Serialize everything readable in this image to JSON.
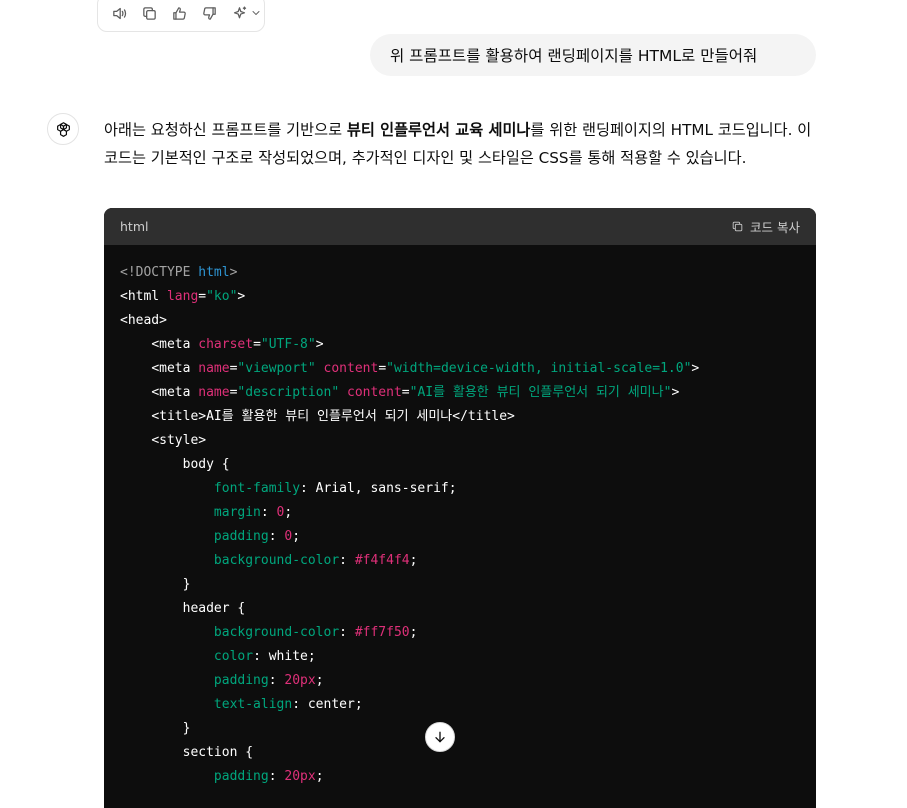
{
  "action_bar": {
    "icons": [
      "speaker-icon",
      "copy-icon",
      "thumbs-up-icon",
      "thumbs-down-icon",
      "sparkle-icon",
      "chevron-down-icon"
    ]
  },
  "user_message": "위 프롬프트를 활용하여 랜딩페이지를 HTML로 만들어줘",
  "assistant": {
    "intro_before": "아래는 요청하신 프롬프트를 기반으로 ",
    "intro_bold": "뷰티 인플루언서 교육 세미나",
    "intro_after": "를 위한 랜딩페이지의 HTML 코드입니다. 이 코드는 기본적인 구조로 작성되었으며, 추가적인 디자인 및 스타일은 CSS를 통해 적용할 수 있습니다."
  },
  "code_block": {
    "language": "html",
    "copy_label": "코드 복사",
    "lines": [
      [
        [
          "doctype",
          "<!DOCTYPE "
        ],
        [
          "kw",
          "html"
        ],
        [
          "doctype",
          ">"
        ]
      ],
      [
        [
          "tag",
          "<html "
        ],
        [
          "attr",
          "lang"
        ],
        [
          "tag",
          "="
        ],
        [
          "str",
          "\"ko\""
        ],
        [
          "tag",
          ">"
        ]
      ],
      [
        [
          "tag",
          "<head>"
        ]
      ],
      [
        [
          "plain",
          "    "
        ],
        [
          "tag",
          "<meta "
        ],
        [
          "attr",
          "charset"
        ],
        [
          "tag",
          "="
        ],
        [
          "str",
          "\"UTF-8\""
        ],
        [
          "tag",
          ">"
        ]
      ],
      [
        [
          "plain",
          "    "
        ],
        [
          "tag",
          "<meta "
        ],
        [
          "attr",
          "name"
        ],
        [
          "tag",
          "="
        ],
        [
          "str",
          "\"viewport\""
        ],
        [
          "plain",
          " "
        ],
        [
          "attr",
          "content"
        ],
        [
          "tag",
          "="
        ],
        [
          "str",
          "\"width=device-width, initial-scale=1.0\""
        ],
        [
          "tag",
          ">"
        ]
      ],
      [
        [
          "plain",
          "    "
        ],
        [
          "tag",
          "<meta "
        ],
        [
          "attr",
          "name"
        ],
        [
          "tag",
          "="
        ],
        [
          "str",
          "\"description\""
        ],
        [
          "plain",
          " "
        ],
        [
          "attr",
          "content"
        ],
        [
          "tag",
          "="
        ],
        [
          "str",
          "\"AI를 활용한 뷰티 인플루언서 되기 세미나\""
        ],
        [
          "tag",
          ">"
        ]
      ],
      [
        [
          "plain",
          "    "
        ],
        [
          "tag",
          "<title>"
        ],
        [
          "plain",
          "AI를 활용한 뷰티 인플루언서 되기 세미나"
        ],
        [
          "tag",
          "</title>"
        ]
      ],
      [
        [
          "plain",
          "    "
        ],
        [
          "tag",
          "<style>"
        ]
      ],
      [
        [
          "plain",
          "        body {"
        ]
      ],
      [
        [
          "plain",
          "            "
        ],
        [
          "prop",
          "font-family"
        ],
        [
          "plain",
          ": Arial, sans-serif;"
        ]
      ],
      [
        [
          "plain",
          "            "
        ],
        [
          "prop",
          "margin"
        ],
        [
          "plain",
          ": "
        ],
        [
          "num",
          "0"
        ],
        [
          "plain",
          ";"
        ]
      ],
      [
        [
          "plain",
          "            "
        ],
        [
          "prop",
          "padding"
        ],
        [
          "plain",
          ": "
        ],
        [
          "num",
          "0"
        ],
        [
          "plain",
          ";"
        ]
      ],
      [
        [
          "plain",
          "            "
        ],
        [
          "prop",
          "background-color"
        ],
        [
          "plain",
          ": "
        ],
        [
          "color",
          "#f4f4f4"
        ],
        [
          "plain",
          ";"
        ]
      ],
      [
        [
          "plain",
          "        }"
        ]
      ],
      [
        [
          "plain",
          "        header {"
        ]
      ],
      [
        [
          "plain",
          "            "
        ],
        [
          "prop",
          "background-color"
        ],
        [
          "plain",
          ": "
        ],
        [
          "color",
          "#ff7f50"
        ],
        [
          "plain",
          ";"
        ]
      ],
      [
        [
          "plain",
          "            "
        ],
        [
          "prop",
          "color"
        ],
        [
          "plain",
          ": white;"
        ]
      ],
      [
        [
          "plain",
          "            "
        ],
        [
          "prop",
          "padding"
        ],
        [
          "plain",
          ": "
        ],
        [
          "num",
          "20px"
        ],
        [
          "plain",
          ";"
        ]
      ],
      [
        [
          "plain",
          "            "
        ],
        [
          "prop",
          "text-align"
        ],
        [
          "plain",
          ": center;"
        ]
      ],
      [
        [
          "plain",
          "        }"
        ]
      ],
      [
        [
          "plain",
          "        section {"
        ]
      ],
      [
        [
          "plain",
          "            "
        ],
        [
          "prop",
          "padding"
        ],
        [
          "plain",
          ": "
        ],
        [
          "num",
          "20px"
        ],
        [
          "plain",
          ";"
        ]
      ]
    ]
  },
  "colors": {
    "code_bg": "#0d0d0d",
    "code_header_bg": "#2f2f2f",
    "attr": "#df3079",
    "string": "#00a67d",
    "keyword": "#2e95d3"
  }
}
